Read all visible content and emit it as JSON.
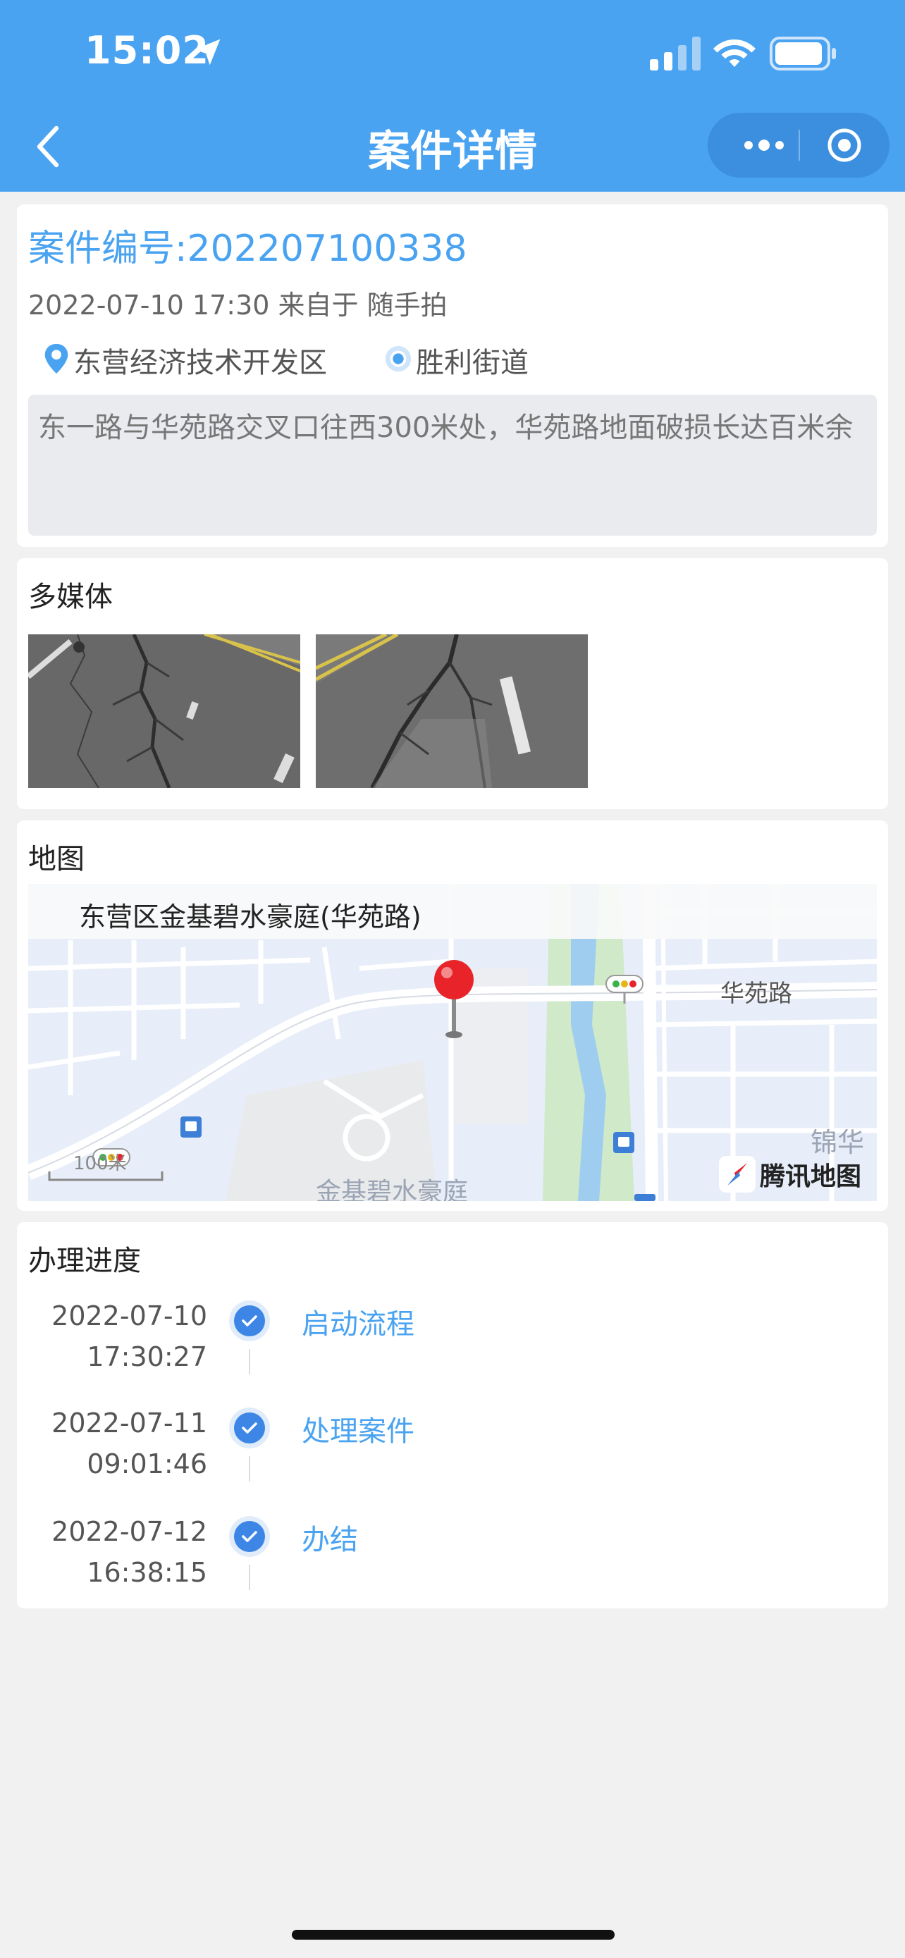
{
  "status_bar": {
    "time": "15:02"
  },
  "nav": {
    "title": "案件详情"
  },
  "case": {
    "number": "案件编号:202207100338",
    "meta": "2022-07-10 17:30 来自于 随手拍",
    "area": "东营经济技术开发区",
    "street": "胜利街道",
    "description": "东一路与华苑路交叉口往西300米处，华苑路地面破损长达百米余"
  },
  "media": {
    "title": "多媒体"
  },
  "map": {
    "title": "地图",
    "place": "东营区金基碧水豪庭(华苑路)",
    "road_label": "华苑路",
    "label_right": "锦华",
    "label_bottom": "金基碧水豪庭",
    "scale": "100米",
    "brand": "腾讯地图"
  },
  "progress": {
    "title": "办理进度",
    "steps": [
      {
        "date": "2022-07-10",
        "time": "17:30:27",
        "label": "启动流程"
      },
      {
        "date": "2022-07-11",
        "time": "09:01:46",
        "label": "处理案件"
      },
      {
        "date": "2022-07-12",
        "time": "16:38:15",
        "label": "办结"
      }
    ]
  },
  "colors": {
    "header": "#4aa3f1",
    "accent": "#4aa3f1",
    "node": "#3d86e6",
    "pin": "#e8242a"
  },
  "icons": [
    "location-arrow-icon",
    "signal-icon",
    "wifi-icon",
    "battery-icon",
    "back-icon",
    "more-icon",
    "target-icon",
    "map-pin-icon",
    "radio-dot-icon",
    "check-icon",
    "map-marker-icon",
    "traffic-light-icon",
    "bus-stop-icon",
    "tencent-compass-icon"
  ]
}
